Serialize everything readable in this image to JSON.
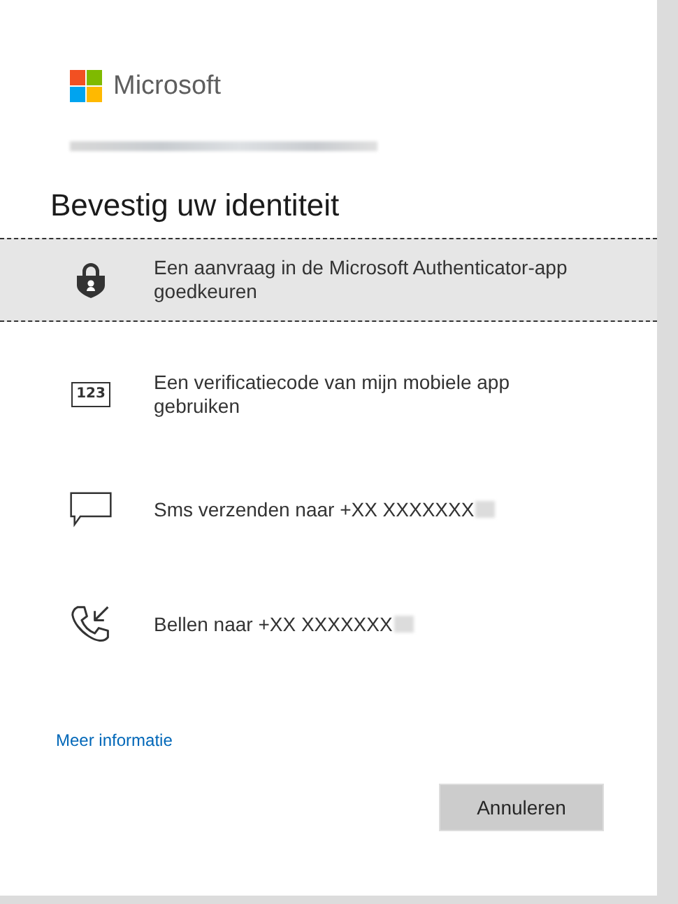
{
  "brand": {
    "name": "Microsoft"
  },
  "heading": "Bevestig uw identiteit",
  "options": [
    {
      "kind": "authenticator",
      "label": "Een aanvraag in de Microsoft Authenticator-app goedkeuren",
      "selected": true
    },
    {
      "kind": "code",
      "icon_text": "123",
      "label": "Een verificatiecode van mijn mobiele app gebruiken",
      "selected": false
    },
    {
      "kind": "sms",
      "label": "Sms verzenden naar +XX XXXXXXX",
      "selected": false
    },
    {
      "kind": "call",
      "label": "Bellen naar +XX XXXXXXX",
      "selected": false
    }
  ],
  "link": "Meer informatie",
  "buttons": [
    "Annuleren"
  ]
}
